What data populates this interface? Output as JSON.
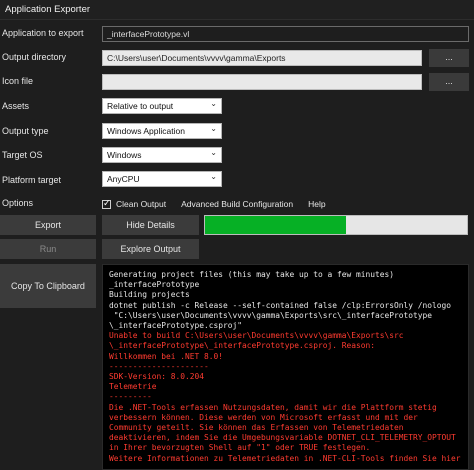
{
  "window": {
    "title": "Application Exporter"
  },
  "fields": {
    "app_label": "Application to export",
    "app_value": "_interfacePrototype.vl",
    "outdir_label": "Output directory",
    "outdir_value": "C:\\Users\\user\\Documents\\vvvv\\gamma\\Exports",
    "icon_label": "Icon file",
    "icon_value": "",
    "browse_label": "..."
  },
  "settings": {
    "assets_label": "Assets",
    "assets_value": "Relative to output",
    "outtype_label": "Output type",
    "outtype_value": "Windows Application",
    "targetos_label": "Target OS",
    "targetos_value": "Windows",
    "platform_label": "Platform target",
    "platform_value": "AnyCPU",
    "options_label": "Options",
    "clean_output_label": "Clean Output",
    "clean_output_checked": true,
    "advanced_label": "Advanced Build Configuration",
    "help_label": "Help"
  },
  "buttons": {
    "export": "Export",
    "hide_details": "Hide Details",
    "run": "Run",
    "explore_output": "Explore Output",
    "copy_clipboard": "Copy To Clipboard"
  },
  "progress": {
    "fraction": 0.54,
    "color": "#06b025"
  },
  "console": {
    "lines": [
      {
        "text": "Generating project files (this may take up to a few minutes)",
        "color": "w"
      },
      {
        "text": "_interfacePrototype",
        "color": "w"
      },
      {
        "text": "Building projects",
        "color": "w"
      },
      {
        "text": "dotnet publish -c Release --self-contained false /clp:ErrorsOnly /nologo",
        "color": "w"
      },
      {
        "text": " \"C:\\Users\\user\\Documents\\vvvv\\gamma\\Exports\\src\\_interfacePrototype",
        "color": "w"
      },
      {
        "text": "\\_interfacePrototype.csproj\"",
        "color": "w"
      },
      {
        "text": "Unable to build C:\\Users\\user\\Documents\\vvvv\\gamma\\Exports\\src",
        "color": "r"
      },
      {
        "text": "\\_interfacePrototype\\_interfacePrototype.csproj. Reason:",
        "color": "r"
      },
      {
        "text": "Willkommen bei .NET 8.0!",
        "color": "r"
      },
      {
        "text": "---------------------",
        "color": "r"
      },
      {
        "text": "SDK-Version: 8.0.204",
        "color": "r"
      },
      {
        "text": "Telemetrie",
        "color": "r"
      },
      {
        "text": "---------",
        "color": "r"
      },
      {
        "text": "Die .NET-Tools erfassen Nutzungsdaten, damit wir die Plattform stetig",
        "color": "r"
      },
      {
        "text": "verbessern können. Diese werden von Microsoft erfasst und mit der",
        "color": "r"
      },
      {
        "text": "Community geteilt. Sie können das Erfassen von Telemetriedaten",
        "color": "r"
      },
      {
        "text": "deaktivieren, indem Sie die Umgebungsvariable DOTNET_CLI_TELEMETRY_OPTOUT",
        "color": "r"
      },
      {
        "text": "in Ihrer bevorzugten Shell auf \"1\" oder TRUE festlegen.",
        "color": "r"
      },
      {
        "text": "Weitere Informationen zu Telemetriedaten in .NET-CLI-Tools finden Sie hier",
        "color": "r"
      }
    ]
  },
  "colors": {
    "background": "#1e1e1e",
    "button": "#3b3b3b",
    "console_bg": "#000000",
    "error_text": "#ff3b30"
  }
}
